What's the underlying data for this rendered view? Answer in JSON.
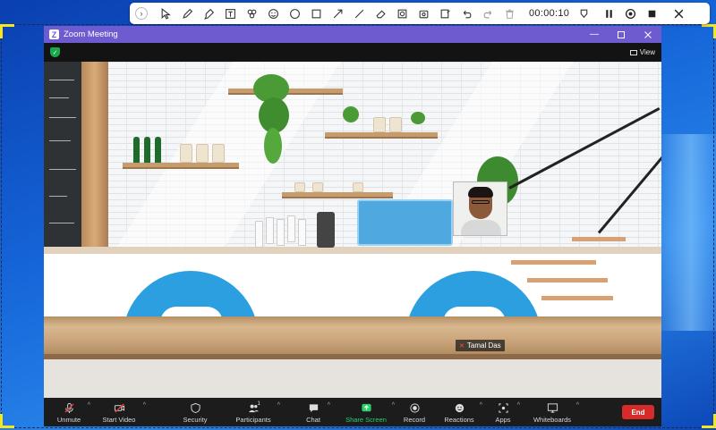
{
  "window": {
    "title": "Zoom Meeting",
    "logo": "Z",
    "view_label": "View"
  },
  "annotation_toolbar": {
    "timer": "00:00:10",
    "tools": [
      "expand-icon",
      "cursor-icon",
      "pen-icon",
      "highlighter-icon",
      "text-icon",
      "stamp-icon",
      "emoji-icon",
      "circle-icon",
      "rectangle-icon",
      "arrow-icon",
      "line-icon",
      "eraser-icon",
      "blur-icon",
      "crop-icon",
      "counter-icon",
      "undo-icon",
      "redo-icon",
      "delete-icon"
    ]
  },
  "participant": {
    "name": "Tamal Das",
    "muted": true
  },
  "toolbar": {
    "unmute": "Unmute",
    "start_video": "Start Video",
    "security": "Security",
    "participants": "Participants",
    "participants_count": "1",
    "chat": "Chat",
    "share_screen": "Share Screen",
    "record": "Record",
    "reactions": "Reactions",
    "apps": "Apps",
    "whiteboards": "Whiteboards",
    "end": "End"
  },
  "colors": {
    "title_bar": "#6e5bd0",
    "share_green": "#2ad06a",
    "end_red": "#d62b2b",
    "chair_blue": "#2c9fe0"
  }
}
